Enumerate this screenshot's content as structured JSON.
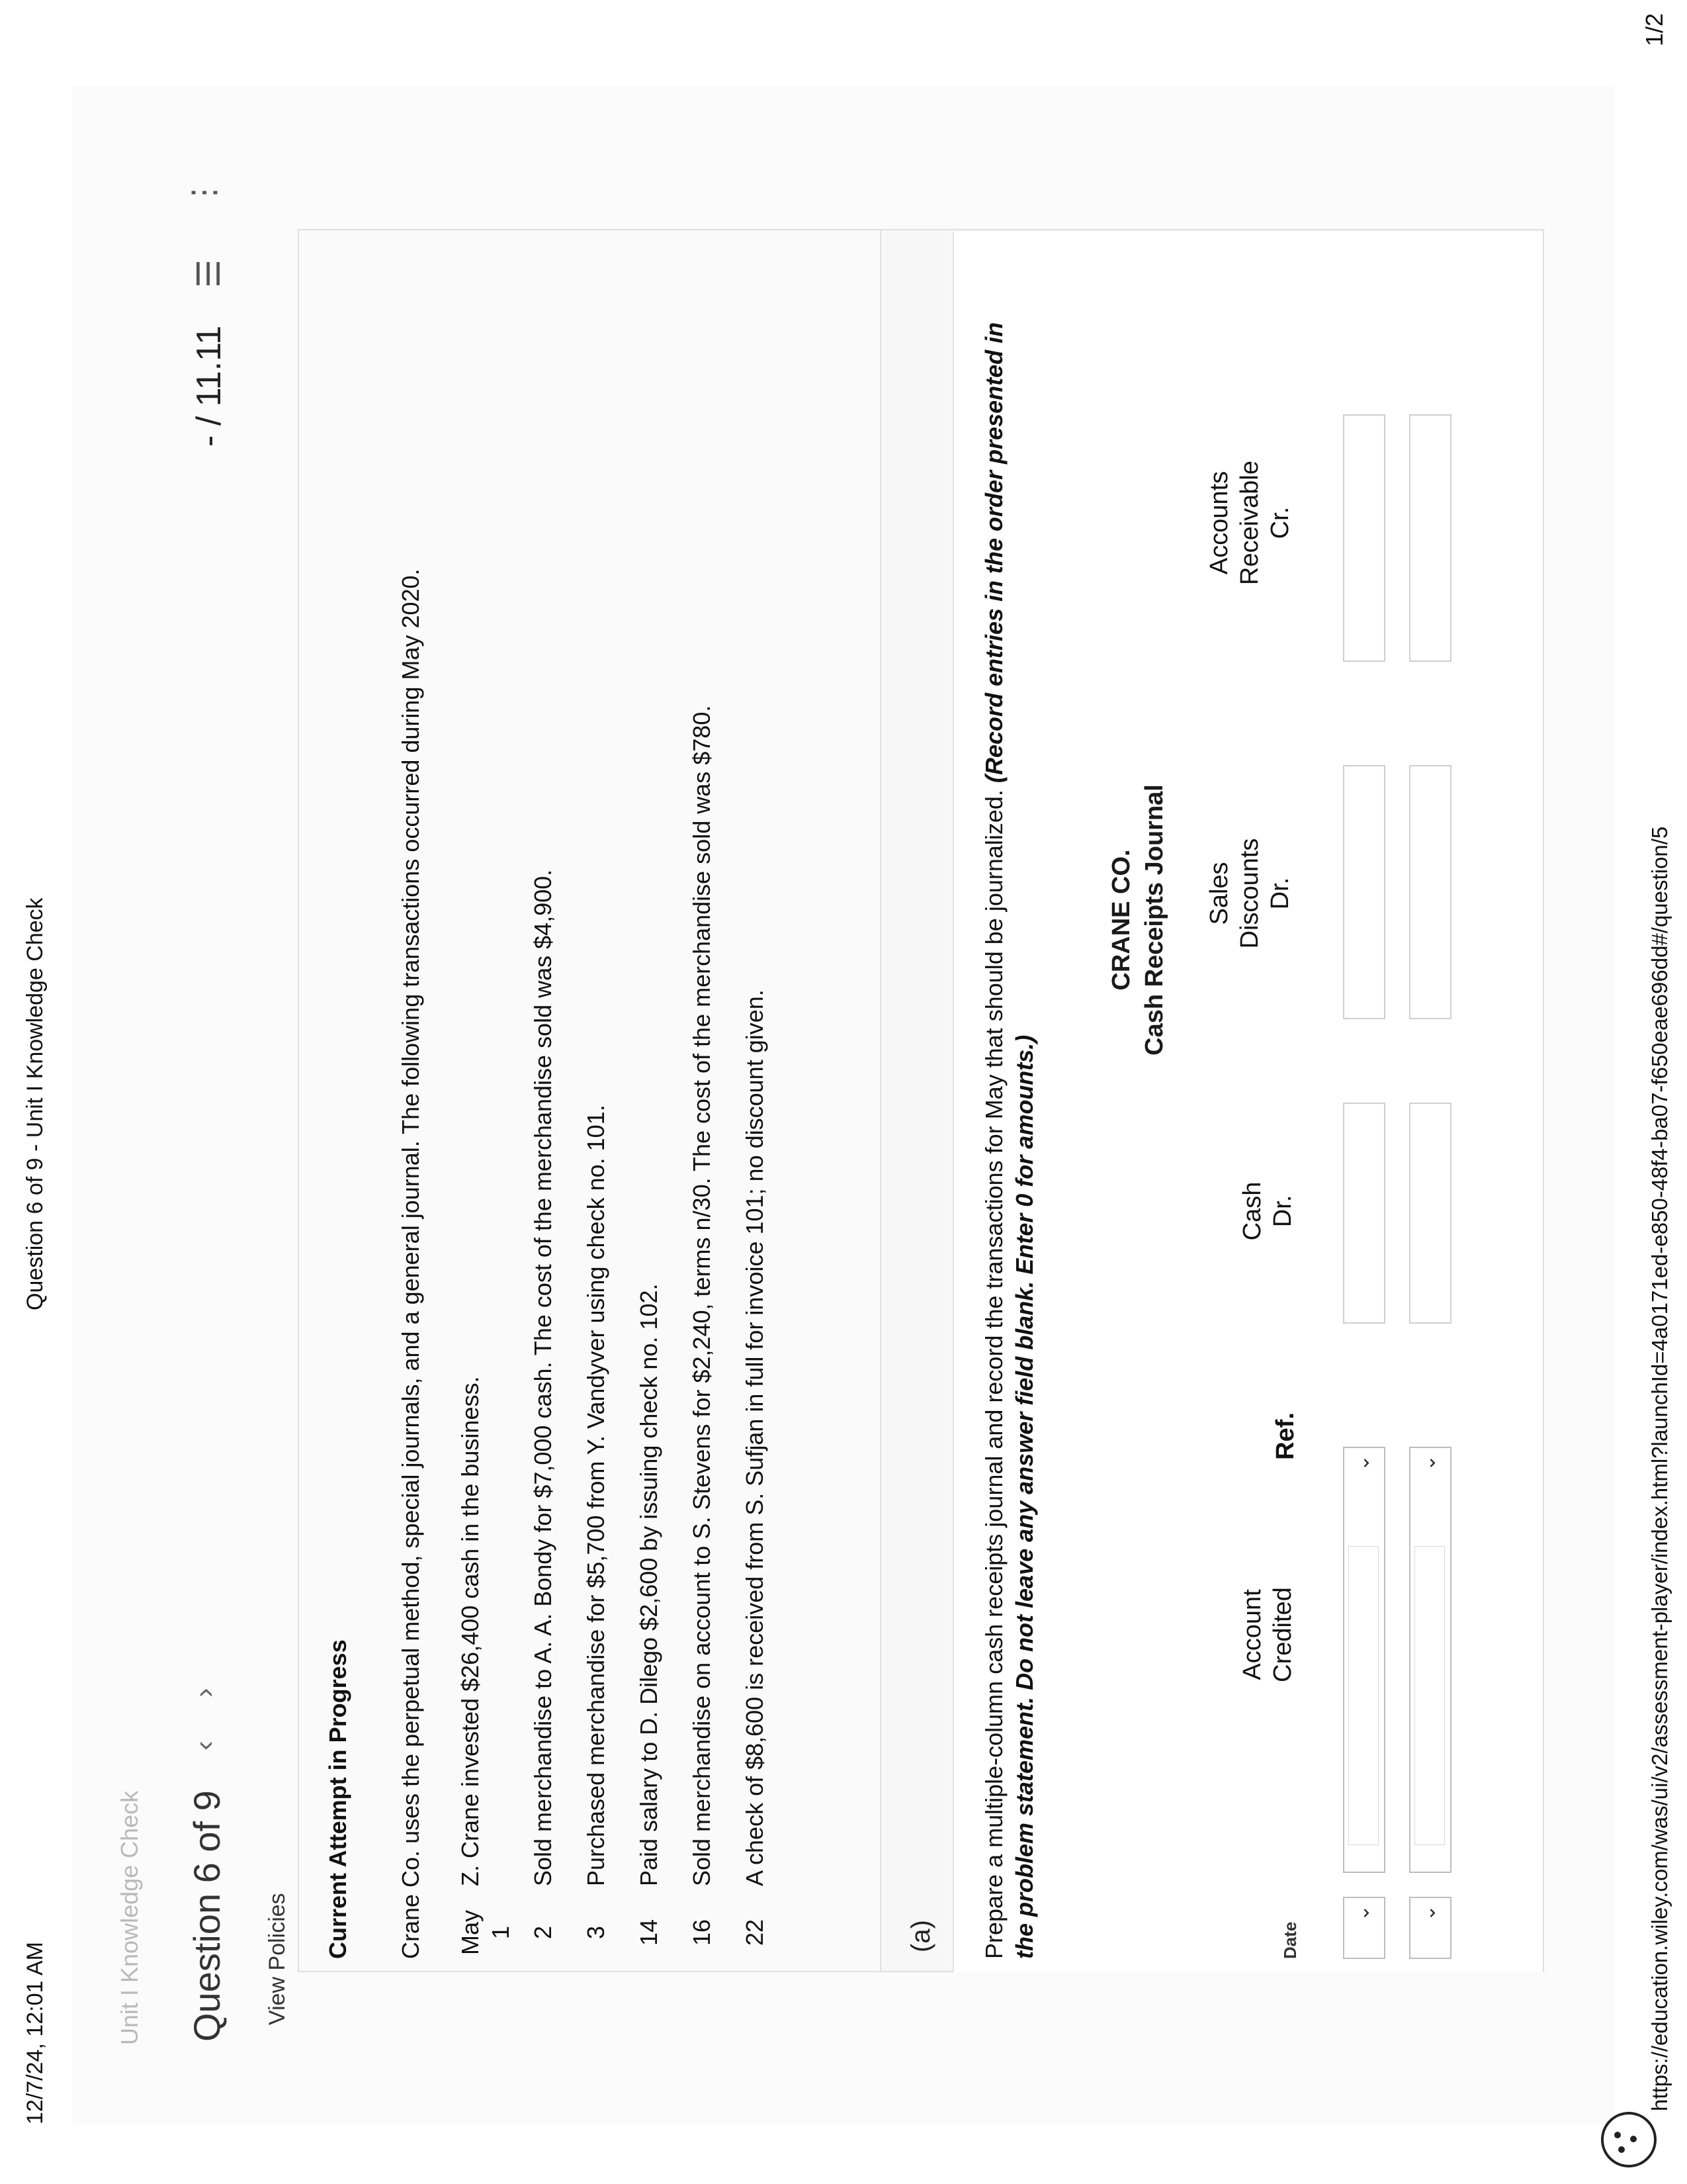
{
  "print": {
    "datetime": "12/7/24, 12:01 AM",
    "doc_title": "Question 6 of 9 - Unit I Knowledge Check",
    "url": "https://education.wiley.com/was/ui/v2/assessment-player/index.html?launchId=4a0171ed-e850-48f4-ba07-f650eae696dd#/question/5",
    "page": "1/2"
  },
  "app": {
    "breadcrumb": "Unit I Knowledge Check",
    "question_label": "Question 6 of 9",
    "prev_icon": "chevron-left-icon",
    "next_icon": "chevron-right-icon",
    "score": "- / 11.11",
    "list_icon": "list-icon",
    "more_icon": "more-vertical-icon",
    "view_policies": "View Policies"
  },
  "problem": {
    "attempt": "Current Attempt in Progress",
    "intro": "Crane Co. uses the perpetual method, special journals, and a general journal. The following transactions occurred during May 2020.",
    "transactions": [
      {
        "month": "May",
        "day": "1",
        "text": "Z. Crane invested $26,400 cash in the business."
      },
      {
        "day": "2",
        "text": "Sold merchandise to A. A. Bondy for $7,000 cash. The cost of the merchandise sold was $4,900."
      },
      {
        "day": "3",
        "text": "Purchased merchandise for $5,700 from Y. Vandyver using check no. 101."
      },
      {
        "day": "14",
        "text": "Paid salary to D. Dilego $2,600 by issuing check no. 102."
      },
      {
        "day": "16",
        "text": "Sold merchandise on account to S. Stevens for $2,240, terms n/30. The cost of the merchandise sold was $780."
      },
      {
        "day": "22",
        "text": "A check of $8,600 is received from S. Sufjan in full for invoice 101; no discount given."
      }
    ]
  },
  "part_a": {
    "label": "(a)",
    "instruction": "Prepare a multiple-column cash receipts journal and record the transactions for May that should be journalized.",
    "instruction_bold": "(Record entries in the order presented in the problem statement. Do not leave any answer field blank. Enter 0 for amounts.)",
    "company": "CRANE CO.",
    "journal_title": "Cash Receipts Journal",
    "columns": {
      "date": "Date",
      "account_1": "Account",
      "account_2": "Credited",
      "ref": "Ref.",
      "cash_1": "Cash",
      "cash_2": "Dr.",
      "disc_1": "Sales",
      "disc_2": "Discounts",
      "disc_3": "Dr.",
      "ar_1": "Accounts",
      "ar_2": "Receivable",
      "ar_3": "Cr."
    }
  }
}
